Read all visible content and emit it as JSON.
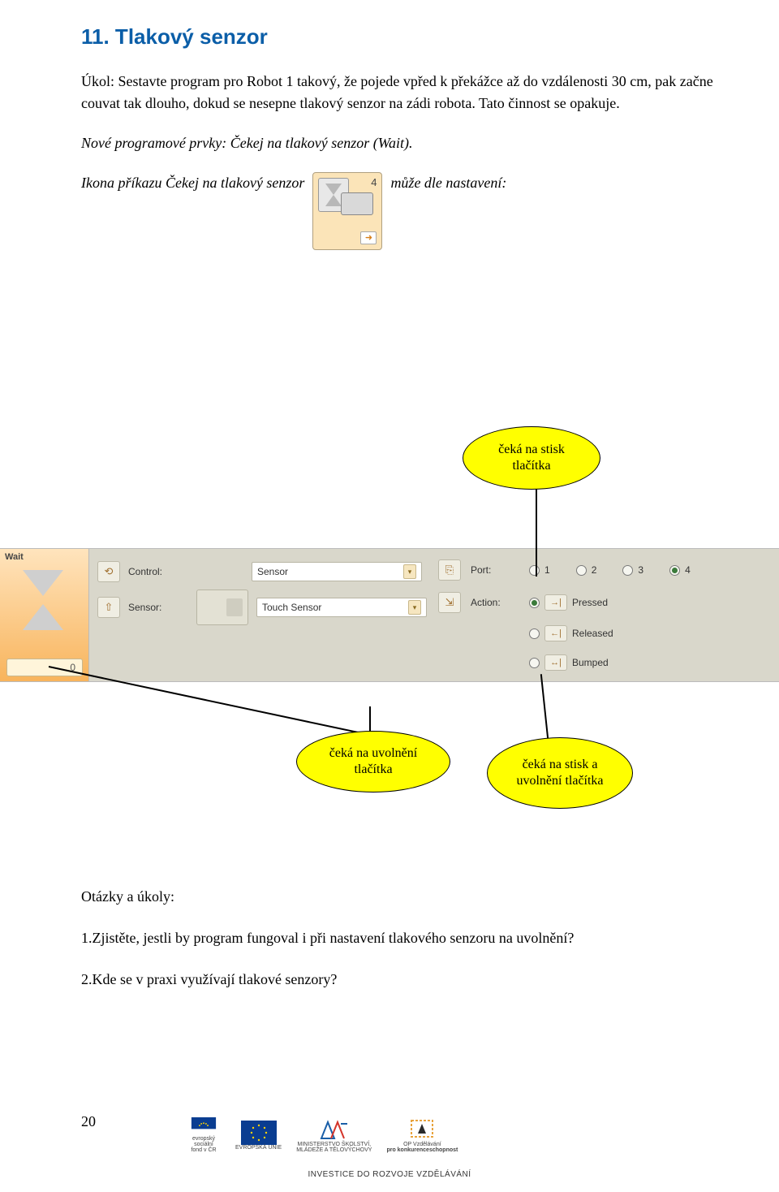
{
  "title": "11. Tlakový senzor",
  "para1": "Úkol: Sestavte program pro Robot 1 takový, že pojede vpřed k překážce až do vzdálenosti 30 cm, pak začne couvat tak dlouho, dokud se nesepne tlakový senzor na zádi robota. Tato činnost se opakuje.",
  "para2": "Nové programové prvky: Čekej na tlakový senzor (Wait).",
  "inline": {
    "before": "Ikona příkazu Čekej na tlakový senzor",
    "after": "může dle nastavení:"
  },
  "icon_port": "4",
  "callouts": {
    "c1": "čeká na stisk tlačítka",
    "c2": "čeká na uvolnění tlačítka",
    "c3": "čeká na stisk a uvolnění tlačítka"
  },
  "panel": {
    "wait_label": "Wait",
    "counter": "0",
    "control_label": "Control:",
    "control_value": "Sensor",
    "sensor_label": "Sensor:",
    "sensor_value": "Touch Sensor",
    "port_label": "Port:",
    "ports": [
      "1",
      "2",
      "3",
      "4"
    ],
    "port_selected": "4",
    "action_label": "Action:",
    "actions": {
      "pressed": "Pressed",
      "released": "Released",
      "bumped": "Bumped"
    },
    "action_selected": "Pressed"
  },
  "questions_heading": "Otázky a úkoly:",
  "q1": "1.Zjistěte, jestli by program fungoval i při nastavení tlakového senzoru na uvolnění?",
  "q2": "2.Kde se v praxi využívají tlakové senzory?",
  "page_number": "20",
  "footer": {
    "esf1": "evropský",
    "esf2": "sociální",
    "esf3": "fond v ČR",
    "eu": "EVROPSKÁ UNIE",
    "msmt1": "MINISTERSTVO ŠKOLSTVÍ,",
    "msmt2": "MLÁDEŽE A TĚLOVÝCHOVY",
    "op1": "OP Vzdělávání",
    "op2": "pro konkurenceschopnost",
    "tagline": "INVESTICE DO ROZVOJE VZDĚLÁVÁNÍ"
  }
}
